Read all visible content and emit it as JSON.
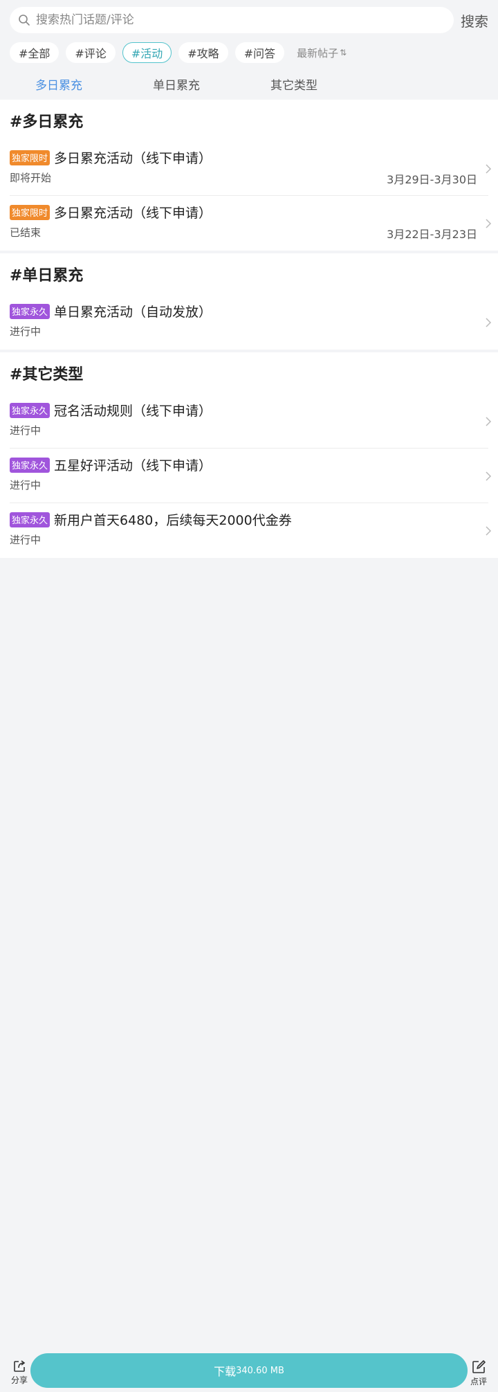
{
  "search": {
    "placeholder": "搜索热门话题/评论",
    "button_label": "搜索"
  },
  "chips": [
    {
      "label": "#全部",
      "active": false
    },
    {
      "label": "#评论",
      "active": false
    },
    {
      "label": "#活动",
      "active": true
    },
    {
      "label": "#攻略",
      "active": false
    },
    {
      "label": "#问答",
      "active": false
    }
  ],
  "sort": {
    "label": "最新帖子",
    "icon": "sort-icon"
  },
  "tabs": [
    {
      "label": "多日累充",
      "active": true
    },
    {
      "label": "单日累充",
      "active": false
    },
    {
      "label": "其它类型",
      "active": false
    }
  ],
  "sections": [
    {
      "title": "#多日累充",
      "items": [
        {
          "badge": "独家限时",
          "badge_color": "#f08a2c",
          "title": "多日累充活动（线下申请）",
          "status": "即将开始",
          "date": "3月29日-3月30日"
        },
        {
          "badge": "独家限时",
          "badge_color": "#f08a2c",
          "title": "多日累充活动（线下申请）",
          "status": "已结束",
          "date": "3月22日-3月23日"
        }
      ]
    },
    {
      "title": "#单日累充",
      "items": [
        {
          "badge": "独家永久",
          "badge_color": "#a055dc",
          "title": "单日累充活动（自动发放）",
          "status": "进行中",
          "date": ""
        }
      ]
    },
    {
      "title": "#其它类型",
      "items": [
        {
          "badge": "独家永久",
          "badge_color": "#a055dc",
          "title": "冠名活动规则（线下申请）",
          "status": "进行中",
          "date": ""
        },
        {
          "badge": "独家永久",
          "badge_color": "#a055dc",
          "title": "五星好评活动（线下申请）",
          "status": "进行中",
          "date": ""
        },
        {
          "badge": "独家永久",
          "badge_color": "#a055dc",
          "title": "新用户首天6480，后续每天2000代金券",
          "status": "进行中",
          "date": ""
        }
      ]
    }
  ],
  "bottom": {
    "share_label": "分享",
    "download_label": "下载",
    "download_size": "340.60 MB",
    "review_label": "点评",
    "accent": "#55c4cb"
  },
  "colors": {
    "active_tab": "#4a90e2",
    "active_chip": "#35a7b4",
    "badge_limited": "#f08a2c",
    "badge_permanent": "#a055dc"
  }
}
